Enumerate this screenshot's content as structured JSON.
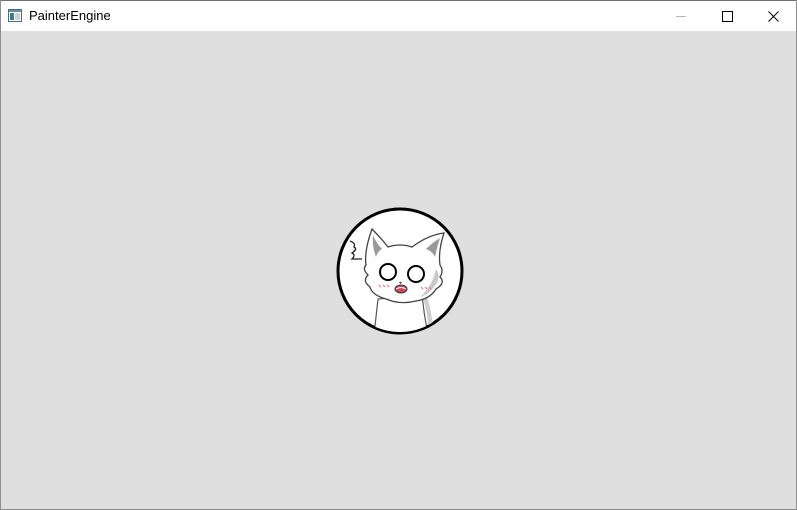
{
  "window": {
    "title": "PainterEngine",
    "icon": "app-window-icon",
    "controls": {
      "minimize_icon": "minimize-icon",
      "maximize_icon": "maximize-icon",
      "close_icon": "close-icon"
    }
  },
  "canvas": {
    "background_color": "#dfdfdf",
    "sprite": {
      "icon": "cat-avatar-icon",
      "border_color": "#000000",
      "fill_color": "#ffffff"
    }
  }
}
